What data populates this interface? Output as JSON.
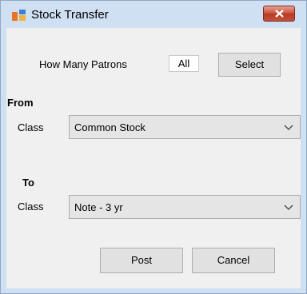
{
  "window": {
    "title": "Stock Transfer",
    "icons": {
      "app": "app-window-icon",
      "close": "close-icon"
    }
  },
  "patrons": {
    "label": "How Many Patrons",
    "value": "All",
    "select_button": "Select"
  },
  "from": {
    "heading": "From",
    "class_label": "Class",
    "class_value": "Common Stock"
  },
  "to": {
    "heading": "To",
    "class_label": "Class",
    "class_value": "Note - 3 yr"
  },
  "actions": {
    "post": "Post",
    "cancel": "Cancel"
  },
  "colors": {
    "frame": "#cfe0f3",
    "client": "#f0f0f0",
    "close_button": "#c9523b"
  }
}
